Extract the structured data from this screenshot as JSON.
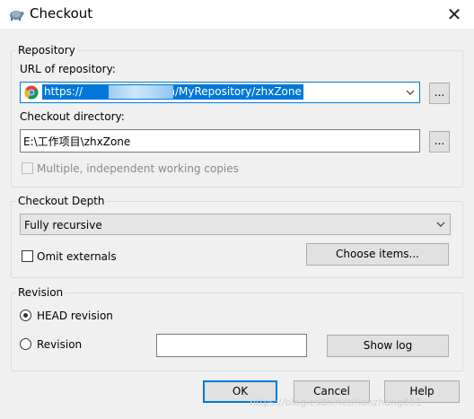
{
  "window": {
    "title": "Checkout",
    "close_glyph": "✕",
    "icon": "tortoisesvn-turtle-icon"
  },
  "repository": {
    "group_label": "Repository",
    "url_label": "URL of repository:",
    "url_value": "https://",
    "url_value_rest": "svn/MyRepository/zhxZone",
    "url_browse": "...",
    "dir_label": "Checkout directory:",
    "dir_value": "E:\\工作项目\\zhxZone",
    "dir_browse": "...",
    "multi_label": "Multiple, independent working copies"
  },
  "depth": {
    "group_label": "Checkout Depth",
    "selected": "Fully recursive",
    "omit_label": "Omit externals",
    "choose_label": "Choose items..."
  },
  "revision": {
    "group_label": "Revision",
    "head_label": "HEAD revision",
    "rev_label": "Revision",
    "rev_value": "",
    "showlog_label": "Show log"
  },
  "buttons": {
    "ok": "OK",
    "cancel": "Cancel",
    "help": "Help"
  },
  "watermark": "https://blog.csdn.net/lianzhang861",
  "colors": {
    "accent": "#0078d7",
    "background": "#f0f0f0",
    "button_face": "#e1e1e1"
  }
}
